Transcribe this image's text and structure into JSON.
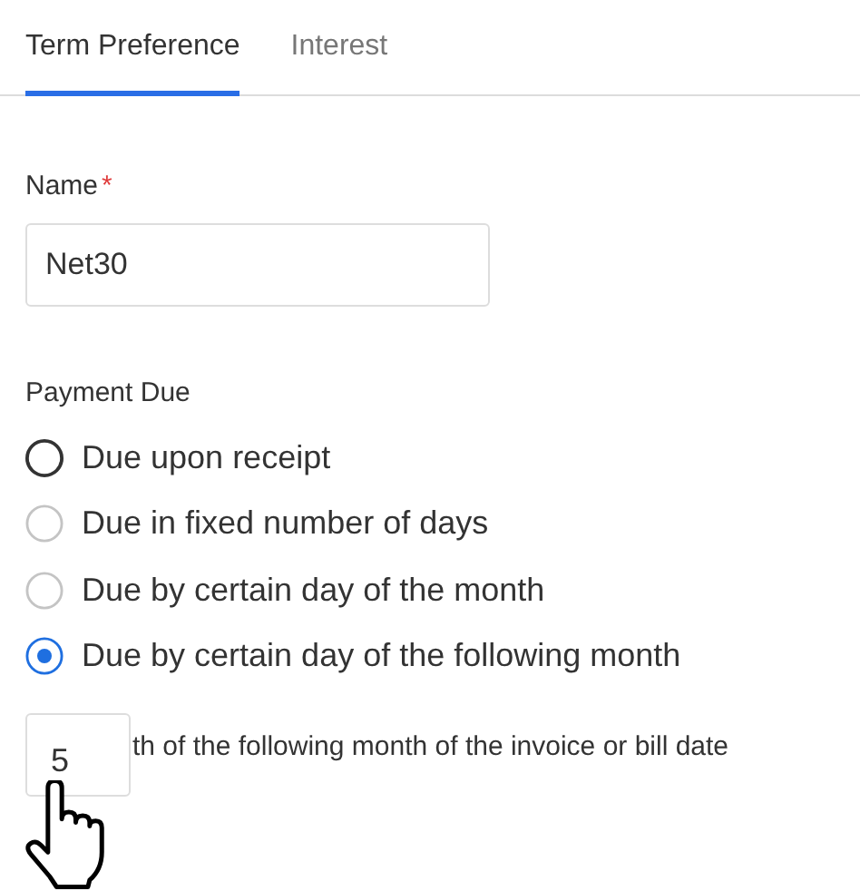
{
  "tabs": [
    {
      "label": "Term Preference",
      "selected": true
    },
    {
      "label": "Interest",
      "selected": false
    }
  ],
  "name_field": {
    "label": "Name",
    "required_mark": "*",
    "value": "Net30"
  },
  "payment_due": {
    "label": "Payment Due",
    "options": [
      {
        "label": "Due upon receipt",
        "selected": false,
        "hovered": true
      },
      {
        "label": "Due in fixed number of days",
        "selected": false,
        "hovered": false
      },
      {
        "label": "Due by certain day of the month",
        "selected": false,
        "hovered": false
      },
      {
        "label": "Due by certain day of the following month",
        "selected": true,
        "hovered": false
      }
    ]
  },
  "day_field": {
    "value": "5",
    "suffix": "th of the following month of the invoice or bill date"
  }
}
